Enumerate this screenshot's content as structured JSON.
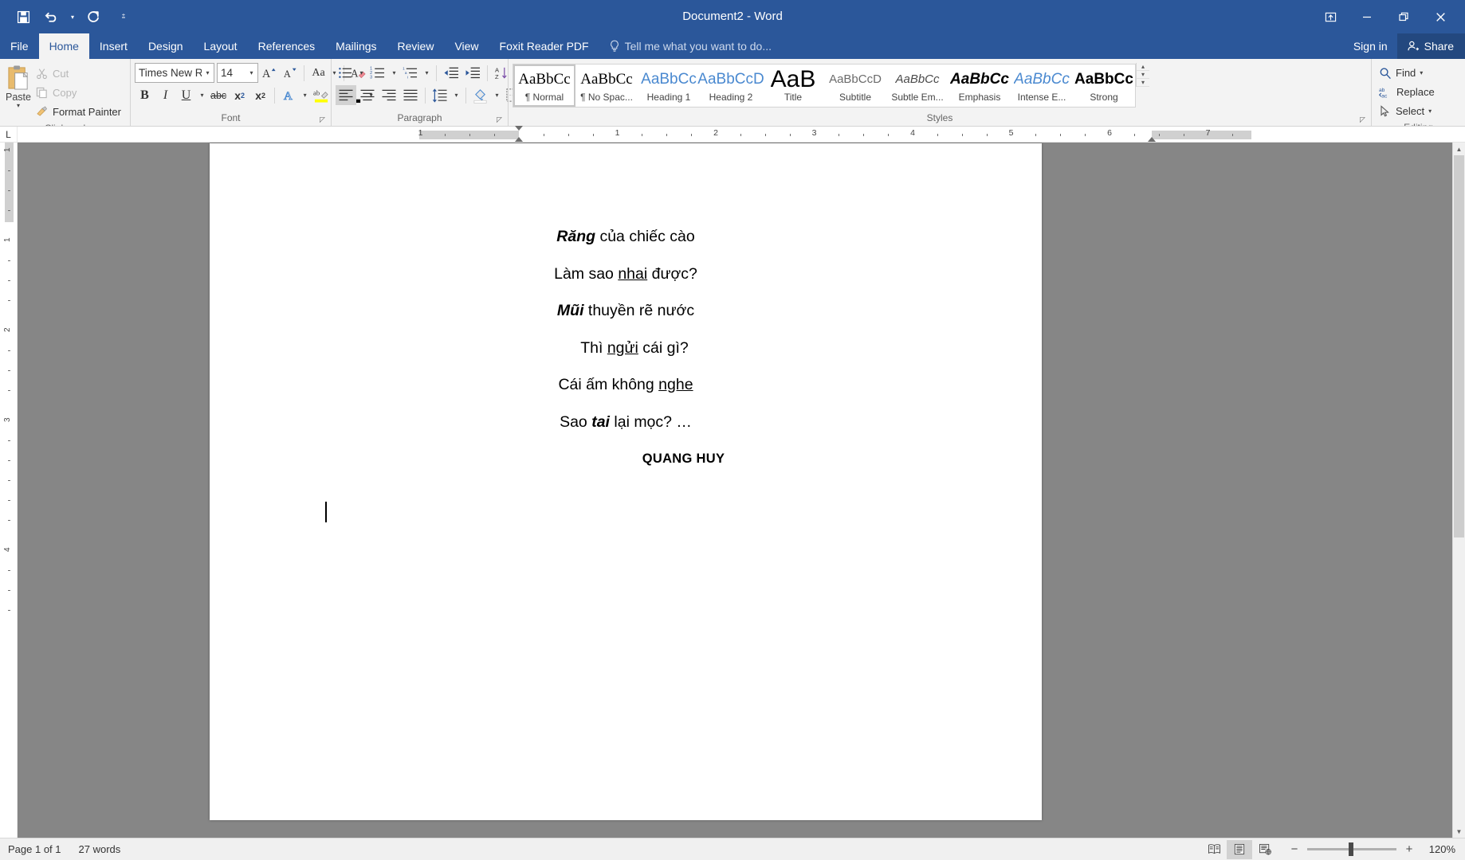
{
  "window": {
    "title": "Document2 - Word",
    "quick_access": [
      {
        "name": "save",
        "icon": "save-icon"
      },
      {
        "name": "undo",
        "icon": "undo-icon"
      },
      {
        "name": "redo",
        "icon": "redo-icon"
      },
      {
        "name": "customize-qat",
        "icon": "customize-quick-access-toolbar-icon"
      }
    ],
    "controls": [
      {
        "name": "ribbon-display-options",
        "icon": "ribbon-display-options-icon"
      },
      {
        "name": "minimize",
        "icon": "minimize-icon"
      },
      {
        "name": "restore",
        "icon": "restore-icon"
      },
      {
        "name": "close",
        "icon": "close-icon"
      }
    ]
  },
  "tabs": [
    {
      "label": "File",
      "active": false
    },
    {
      "label": "Home",
      "active": true
    },
    {
      "label": "Insert",
      "active": false
    },
    {
      "label": "Design",
      "active": false
    },
    {
      "label": "Layout",
      "active": false
    },
    {
      "label": "References",
      "active": false
    },
    {
      "label": "Mailings",
      "active": false
    },
    {
      "label": "Review",
      "active": false
    },
    {
      "label": "View",
      "active": false
    },
    {
      "label": "Foxit Reader PDF",
      "active": false
    }
  ],
  "tell_me": {
    "placeholder": "Tell me what you want to do...",
    "icon": "lightbulb-icon"
  },
  "account": {
    "sign_in": "Sign in",
    "share": "Share",
    "share_icon": "person-add-icon"
  },
  "ribbon": {
    "clipboard": {
      "label": "Clipboard",
      "paste": "Paste",
      "items": [
        {
          "label": "Cut",
          "icon": "scissors-icon",
          "enabled": false
        },
        {
          "label": "Copy",
          "icon": "copy-icon",
          "enabled": false
        },
        {
          "label": "Format Painter",
          "icon": "format-painter-icon",
          "enabled": true
        }
      ]
    },
    "font": {
      "label": "Font",
      "font_name": "Times New Ro",
      "font_size": "14",
      "buttons": [
        {
          "name": "grow-font",
          "glyph": "A"
        },
        {
          "name": "shrink-font",
          "glyph": "A"
        },
        {
          "name": "change-case",
          "glyph": "Aa"
        },
        {
          "name": "clear-formatting",
          "glyph": "A"
        },
        {
          "name": "bold",
          "glyph": "B"
        },
        {
          "name": "italic",
          "glyph": "I"
        },
        {
          "name": "underline",
          "glyph": "U"
        },
        {
          "name": "strikethrough",
          "glyph": "abc"
        },
        {
          "name": "subscript",
          "glyph": "x₂"
        },
        {
          "name": "superscript",
          "glyph": "x²"
        },
        {
          "name": "text-effects",
          "glyph": "A"
        },
        {
          "name": "text-highlight-color",
          "glyph": "ab"
        },
        {
          "name": "font-color",
          "glyph": "A"
        }
      ]
    },
    "paragraph": {
      "label": "Paragraph",
      "buttons": [
        {
          "name": "bullets"
        },
        {
          "name": "numbering"
        },
        {
          "name": "multilevel-list"
        },
        {
          "name": "decrease-indent"
        },
        {
          "name": "increase-indent"
        },
        {
          "name": "sort"
        },
        {
          "name": "show-formatting-marks"
        },
        {
          "name": "align-left",
          "active": true
        },
        {
          "name": "align-center"
        },
        {
          "name": "align-right"
        },
        {
          "name": "justify"
        },
        {
          "name": "line-spacing"
        },
        {
          "name": "shading"
        },
        {
          "name": "borders"
        }
      ]
    },
    "styles": {
      "label": "Styles",
      "items": [
        {
          "preview": "AaBbCc",
          "name": "¶ Normal",
          "selected": true,
          "color": "#000000",
          "italic": false,
          "bold": false,
          "serif": true
        },
        {
          "preview": "AaBbCc",
          "name": "¶ No Spac...",
          "selected": false,
          "color": "#000000",
          "italic": false,
          "bold": false,
          "serif": true
        },
        {
          "preview": "AaBbCc",
          "name": "Heading 1",
          "selected": false,
          "color": "#4a89d0",
          "italic": false,
          "bold": false,
          "serif": false
        },
        {
          "preview": "AaBbCcD",
          "name": "Heading 2",
          "selected": false,
          "color": "#4a89d0",
          "italic": false,
          "bold": false,
          "serif": false
        },
        {
          "preview": "AaB",
          "name": "Title",
          "selected": false,
          "color": "#000000",
          "italic": false,
          "bold": false,
          "serif": false
        },
        {
          "preview": "AaBbCcD",
          "name": "Subtitle",
          "selected": false,
          "color": "#6b6b6b",
          "italic": false,
          "bold": false,
          "serif": false
        },
        {
          "preview": "AaBbCc",
          "name": "Subtle Em...",
          "selected": false,
          "color": "#4a4a4a",
          "italic": true,
          "bold": false,
          "serif": false
        },
        {
          "preview": "AaBbCc",
          "name": "Emphasis",
          "selected": false,
          "color": "#000000",
          "italic": true,
          "bold": true,
          "serif": false
        },
        {
          "preview": "AaBbCc",
          "name": "Intense E...",
          "selected": false,
          "color": "#4a89d0",
          "italic": true,
          "bold": false,
          "serif": false
        },
        {
          "preview": "AaBbCc",
          "name": "Strong",
          "selected": false,
          "color": "#000000",
          "italic": false,
          "bold": true,
          "serif": false
        }
      ]
    },
    "editing": {
      "label": "Editing",
      "items": [
        {
          "label": "Find",
          "icon": "search-icon",
          "has_caret": true
        },
        {
          "label": "Replace",
          "icon": "replace-icon",
          "has_caret": false
        },
        {
          "label": "Select",
          "icon": "cursor-arrow-icon",
          "has_caret": true
        }
      ]
    }
  },
  "ruler": {
    "tab_selector": "L",
    "numbers": [
      "1",
      "1",
      "2",
      "3",
      "4",
      "5",
      "6",
      "7"
    ],
    "v_numbers": [
      "1",
      "1",
      "2",
      "3"
    ]
  },
  "document": {
    "lines": [
      {
        "indent": 0,
        "runs": [
          {
            "text": "Răng",
            "bold_italic": true
          },
          {
            "text": " của chiếc cào"
          }
        ]
      },
      {
        "indent": 0,
        "runs": [
          {
            "text": "Làm sao "
          },
          {
            "text": "nhai",
            "underline": true
          },
          {
            "text": " được?"
          }
        ]
      },
      {
        "indent": 0,
        "runs": [
          {
            "text": "Mũi",
            "bold_italic": true
          },
          {
            "text": " thuyền rẽ nước"
          }
        ]
      },
      {
        "indent": 1,
        "runs": [
          {
            "text": "Thì "
          },
          {
            "text": "ngửi",
            "underline": true
          },
          {
            "text": " cái gì?"
          }
        ]
      },
      {
        "indent": 0,
        "runs": [
          {
            "text": "Cái ấm không "
          },
          {
            "text": "nghe",
            "underline": true
          }
        ]
      },
      {
        "indent": 0,
        "runs": [
          {
            "text": "Sao "
          },
          {
            "text": "tai",
            "bold_italic": true
          },
          {
            "text": " lại mọc? …"
          }
        ]
      }
    ],
    "byline": "QUANG HUY"
  },
  "status": {
    "page": "Page 1 of 1",
    "words": "27 words",
    "views": [
      {
        "name": "read-mode",
        "active": false
      },
      {
        "name": "print-layout",
        "active": true
      },
      {
        "name": "web-layout",
        "active": false
      }
    ],
    "zoom_out": "−",
    "zoom_in": "+",
    "zoom_level": "120%"
  },
  "colors": {
    "brand_blue": "#2b579a",
    "share_blue": "#23487f",
    "ribbon_bg": "#f3f3f3",
    "canvas_gray": "#868686",
    "accent_blue": "#4a89d0"
  }
}
